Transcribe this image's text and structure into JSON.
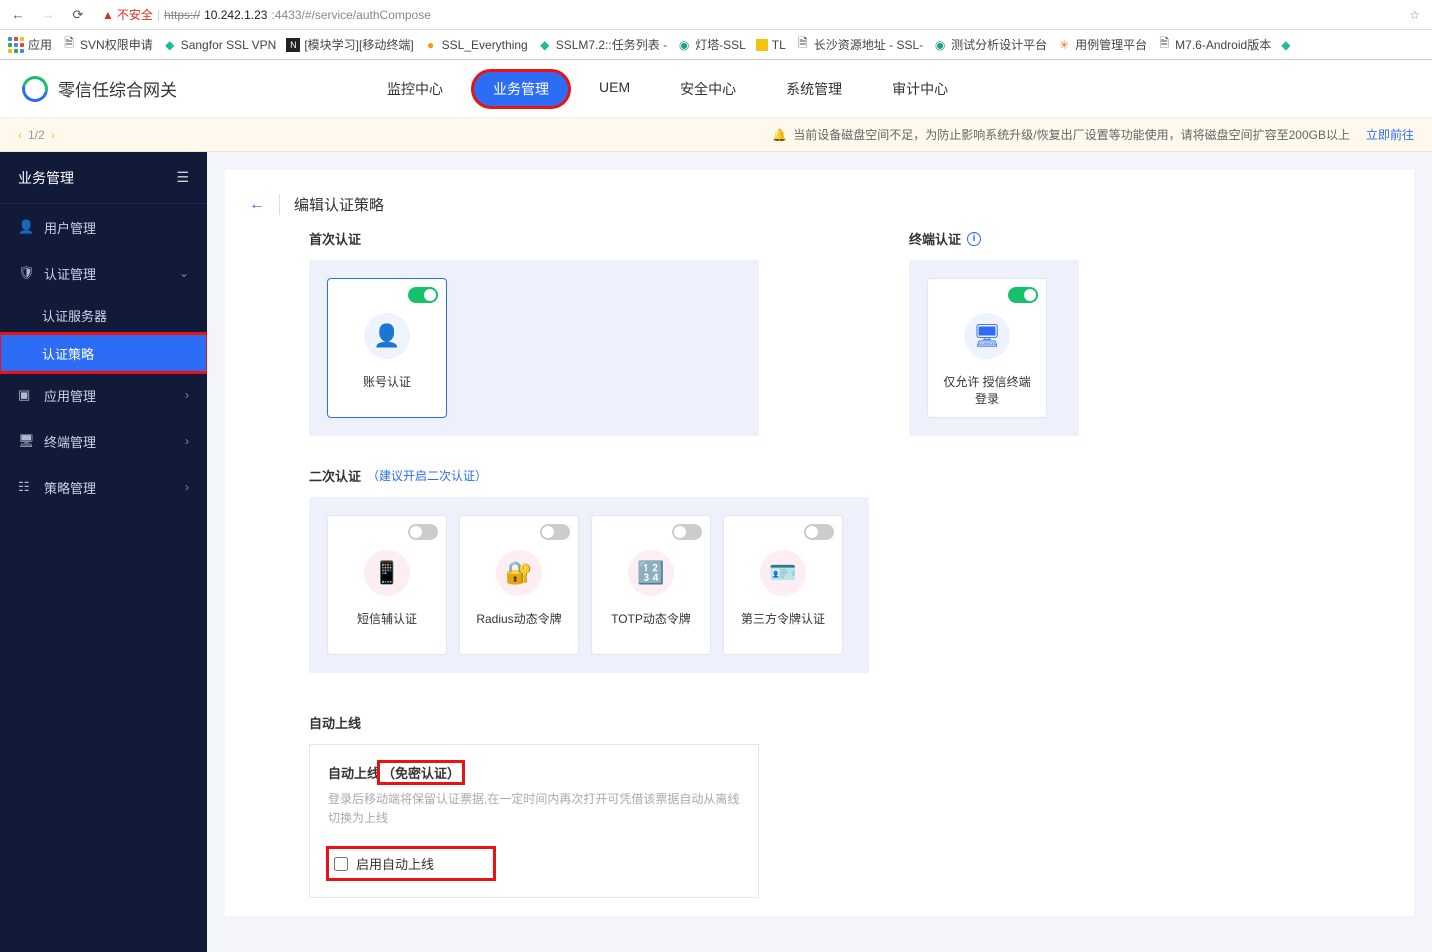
{
  "browser": {
    "insecure_label": "不安全",
    "url_https": "https://",
    "url_host": "10.242.1.23",
    "url_rest": ":4433/#/service/authCompose"
  },
  "bookmarks": {
    "apps": "应用",
    "items": [
      {
        "label": "SVN权限申请",
        "color": "#888"
      },
      {
        "label": "Sangfor SSL VPN",
        "color": "#1abc9c"
      },
      {
        "label": "[模块学习][移动终端]",
        "color": "#222"
      },
      {
        "label": "SSL_Everything",
        "color": "#f39c12"
      },
      {
        "label": "SSLM7.2::任务列表 - ",
        "color": "#1abc9c"
      },
      {
        "label": "灯塔-SSL",
        "color": "#16a085"
      },
      {
        "label": "TL",
        "color": "#f1c40f"
      },
      {
        "label": "长沙资源地址 - SSL-",
        "color": "#888"
      },
      {
        "label": "测试分析设计平台",
        "color": "#16a085"
      },
      {
        "label": "用例管理平台",
        "color": "#e67e22"
      },
      {
        "label": "M7.6-Android版本",
        "color": "#888"
      }
    ]
  },
  "header": {
    "brand": "零信任综合网关",
    "nav": [
      "监控中心",
      "业务管理",
      "UEM",
      "安全中心",
      "系统管理",
      "审计中心"
    ],
    "active": "业务管理"
  },
  "alert": {
    "pager": "1/2",
    "text": "当前设备磁盘空间不足，为防止影响系统升级/恢复出厂设置等功能使用，请将磁盘空间扩容至200GB以上",
    "link": "立即前往"
  },
  "sidebar": {
    "title": "业务管理",
    "items": [
      {
        "label": "用户管理",
        "icon": "user",
        "expand": false
      },
      {
        "label": "认证管理",
        "icon": "shield",
        "expand": true,
        "children": [
          {
            "label": "认证服务器",
            "active": false
          },
          {
            "label": "认证策略",
            "active": true
          }
        ]
      },
      {
        "label": "应用管理",
        "icon": "app",
        "expand": false,
        "chev": true
      },
      {
        "label": "终端管理",
        "icon": "device",
        "expand": false,
        "chev": true
      },
      {
        "label": "策略管理",
        "icon": "policy",
        "expand": false,
        "chev": true
      }
    ]
  },
  "page": {
    "title": "编辑认证策略",
    "first_auth": "首次认证",
    "terminal_auth": "终端认证",
    "card_account": "账号认证",
    "card_trusted": "仅允许 授信终端登录",
    "second_auth_label": "二次认证",
    "second_auth_hint": "（建议开启二次认证）",
    "second_cards": [
      "短信辅认证",
      "Radius动态令牌",
      "TOTP动态令牌",
      "第三方令牌认证"
    ],
    "auto_section_title": "自动上线",
    "auto_head_1": "自动上线",
    "auto_head_2": "（免密认证）",
    "auto_desc": "登录后移动端将保留认证票据,在一定时间内再次打开可凭借该票据自动从离线切换为上线",
    "auto_check_label": "启用自动上线"
  }
}
